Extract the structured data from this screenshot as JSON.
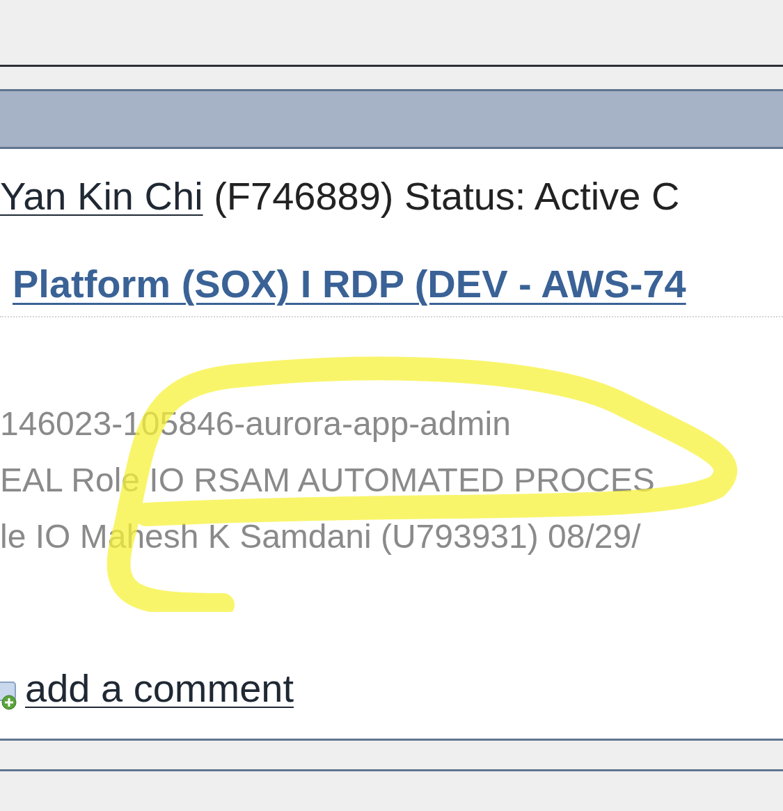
{
  "user": {
    "name": "Yan Kin Chi",
    "details": "(F746889) Status: Active C"
  },
  "entitlement": {
    "title": "Platform (SOX) I RDP (DEV - AWS-74"
  },
  "details": [
    "146023-105846-aurora-app-admin",
    "EAL Role IO RSAM AUTOMATED PROCES",
    "le IO Mahesh K Samdani (U793931) 08/29/"
  ],
  "comment_link": "add a comment"
}
